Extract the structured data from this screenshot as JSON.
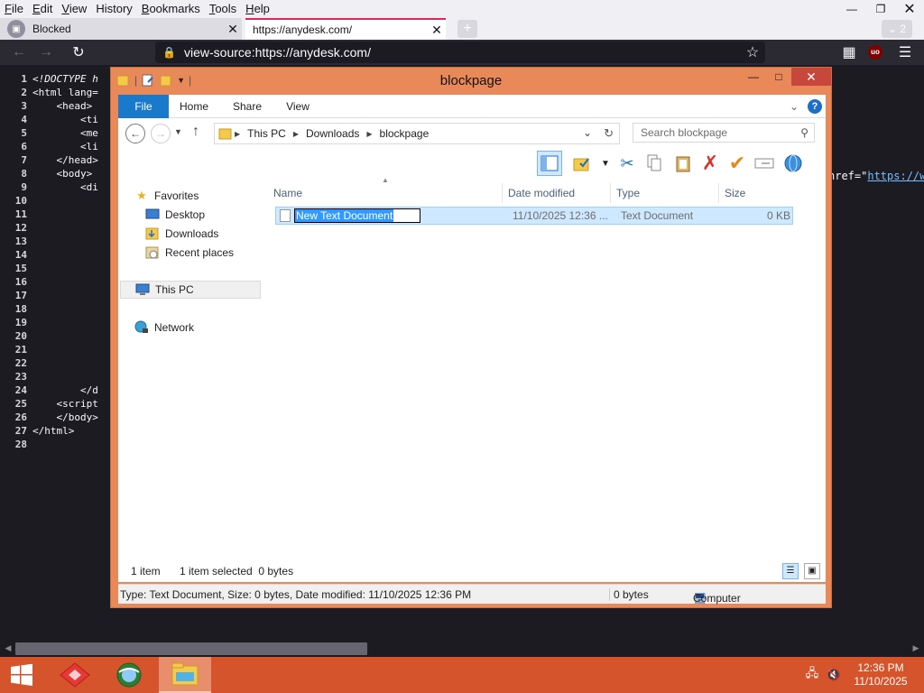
{
  "menubar": {
    "items": [
      {
        "ul": "F",
        "rest": "ile"
      },
      {
        "ul": "E",
        "rest": "dit"
      },
      {
        "ul": "V",
        "rest": "iew"
      },
      {
        "ul": "",
        "rest": "History",
        "ulmid": "i"
      },
      {
        "ul": "B",
        "rest": "ookmarks"
      },
      {
        "ul": "T",
        "rest": "ools"
      },
      {
        "ul": "H",
        "rest": "elp"
      }
    ]
  },
  "tabs": [
    {
      "title": "Blocked"
    },
    {
      "title": "https://anydesk.com/"
    }
  ],
  "tab_overflow_count": "2",
  "urlbar": {
    "url": "view-source:https://anydesk.com/"
  },
  "source": {
    "lines": [
      {
        "n": "1",
        "code": "<!DOCTYPE h"
      },
      {
        "n": "2",
        "code": "<html lang="
      },
      {
        "n": "3",
        "code": "    <head>"
      },
      {
        "n": "4",
        "code": "        <ti"
      },
      {
        "n": "5",
        "code": "        <me"
      },
      {
        "n": "6",
        "code": "        <li"
      },
      {
        "n": "7",
        "code": "    </head>"
      },
      {
        "n": "8",
        "code": "    <body>"
      },
      {
        "n": "9",
        "code": "        <di"
      },
      {
        "n": "10",
        "code": ""
      },
      {
        "n": "11",
        "code": ""
      },
      {
        "n": "12",
        "code": ""
      },
      {
        "n": "13",
        "code": ""
      },
      {
        "n": "14",
        "code": ""
      },
      {
        "n": "15",
        "code": ""
      },
      {
        "n": "16",
        "code": ""
      },
      {
        "n": "17",
        "code": ""
      },
      {
        "n": "18",
        "code": ""
      },
      {
        "n": "19",
        "code": ""
      },
      {
        "n": "20",
        "code": ""
      },
      {
        "n": "21",
        "code": ""
      },
      {
        "n": "22",
        "code": ""
      },
      {
        "n": "23",
        "code": ""
      },
      {
        "n": "24",
        "code": "        </d"
      },
      {
        "n": "25",
        "code": "    <script"
      },
      {
        "n": "26",
        "code": "    </body>"
      },
      {
        "n": "27",
        "code": "</html>"
      },
      {
        "n": "28",
        "code": ""
      }
    ],
    "right_fragment": "href=\"",
    "right_link": "https://w"
  },
  "explorer": {
    "title": "blockpage",
    "ribbon_tabs": [
      "File",
      "Home",
      "Share",
      "View"
    ],
    "breadcrumb": [
      "This PC",
      "Downloads",
      "blockpage"
    ],
    "search_placeholder": "Search blockpage",
    "nav": {
      "favorites": "Favorites",
      "desktop": "Desktop",
      "downloads": "Downloads",
      "recent": "Recent places",
      "thispc": "This PC",
      "network": "Network"
    },
    "columns": {
      "name": "Name",
      "date": "Date modified",
      "type": "Type",
      "size": "Size"
    },
    "file": {
      "name": "New Text Document",
      "date": "11/10/2025 12:36 ...",
      "type": "Text Document",
      "size": "0 KB"
    },
    "item_count": "1 item",
    "selected": "1 item selected  0 bytes",
    "status_text": "Type: Text Document, Size: 0 bytes, Date modified: 11/10/2025 12:36 PM",
    "status_size": "0 bytes",
    "status_location": "Computer"
  },
  "taskbar": {
    "time": "12:36 PM",
    "date": "11/10/2025"
  },
  "colors": {
    "accent": "#1979ca",
    "window_frame": "#e9895a",
    "taskbar": "#d5542c",
    "tab_highlight": "#e22850"
  }
}
